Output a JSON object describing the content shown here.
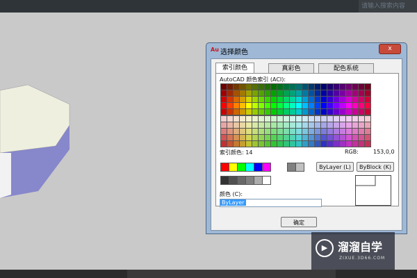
{
  "app": {
    "top_text": "",
    "search_placeholder": "请输入搜索内容"
  },
  "dialog": {
    "logo": "Au",
    "title": "选择颜色",
    "close_glyph": "x",
    "tabs": [
      {
        "label": "索引颜色",
        "active": true
      },
      {
        "label": "真彩色",
        "active": false
      },
      {
        "label": "配色系统",
        "active": false
      }
    ],
    "aci_label": "AutoCAD 颜色索引 (ACI):",
    "index_label": "索引颜色: 14",
    "rgb_label": "RGB:",
    "rgb_value": "153,0,0",
    "bylayer_button": "ByLayer (L)",
    "byblock_button": "ByBlock (K)",
    "color_label": "颜色 (C):",
    "color_value": "ByLayer",
    "ok_button": "确定",
    "standard_colors": [
      "#ff0000",
      "#ffff00",
      "#00ff00",
      "#00ffff",
      "#0000ff",
      "#ff00ff"
    ],
    "white_black": [
      "#808080",
      "#c0c0c0"
    ],
    "gray_shades": [
      "#333333",
      "#505050",
      "#696969",
      "#808080",
      "#adadad",
      "#ffffff"
    ]
  },
  "watermark": {
    "brand": "溜溜自学",
    "url": "ZIXUE.3D66.COM",
    "icon": "play-icon"
  }
}
